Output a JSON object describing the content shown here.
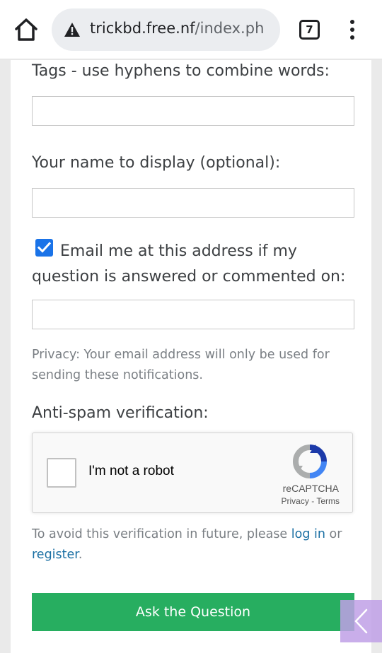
{
  "browser": {
    "url_host": "trickbd.free.nf",
    "url_path": "/index.ph",
    "tab_count": "7"
  },
  "form": {
    "tags_label": "Tags - use hyphens to combine words:",
    "name_label": "Your name to display (optional):",
    "email_notify_line1": "Email me at this address if my",
    "email_notify_line2": "question is answered or commented on:",
    "email_notify_checked": true,
    "privacy_note": "Privacy: Your email address will only be used for sending these notifications.",
    "antispam_label": "Anti-spam verification:",
    "avoid_prefix": "To avoid this verification in future, please ",
    "login_link": "log in",
    "avoid_middle": " or ",
    "register_link": "register",
    "avoid_suffix": ".",
    "submit_label": "Ask the Question"
  },
  "recaptcha": {
    "label": "I'm not a robot",
    "brand": "reCAPTCHA",
    "privacy": "Privacy",
    "separator": "-",
    "terms": "Terms"
  },
  "colors": {
    "submit_bg": "#27ae60",
    "link": "#1a6fa3",
    "checkbox": "#1a73e8"
  }
}
